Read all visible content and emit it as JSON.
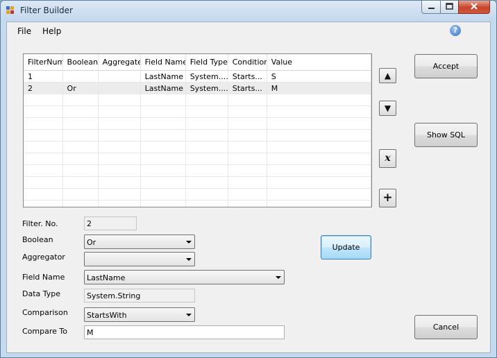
{
  "window": {
    "title": "Filter Builder"
  },
  "menu": {
    "file": "File",
    "help": "Help"
  },
  "help_icon_glyph": "?",
  "grid": {
    "columns": [
      "FilterNum",
      "Boolean",
      "Aggregate",
      "Field Name",
      "Field Type",
      "Condition",
      "Value"
    ],
    "rows": [
      [
        "1",
        "",
        "",
        "LastName",
        "System....",
        "Starts...",
        "S"
      ],
      [
        "2",
        "Or",
        "",
        "LastName",
        "System....",
        "Starts...",
        "M"
      ]
    ]
  },
  "side_buttons": {
    "up_glyph": "▲",
    "down_glyph": "▼",
    "delete_glyph": "x",
    "add_glyph": "+"
  },
  "buttons": {
    "accept": "Accept",
    "show_sql": "Show SQL",
    "update": "Update",
    "cancel": "Cancel"
  },
  "form": {
    "filter_no_label": "Filter. No.",
    "filter_no_value": "2",
    "boolean_label": "Boolean",
    "boolean_value": "Or",
    "aggregator_label": "Aggregator",
    "aggregator_value": "",
    "field_name_label": "Field Name",
    "field_name_value": "LastName",
    "data_type_label": "Data Type",
    "data_type_value": "System.String",
    "comparison_label": "Comparison",
    "comparison_value": "StartsWith",
    "compare_to_label": "Compare To",
    "compare_to_value": "M"
  }
}
